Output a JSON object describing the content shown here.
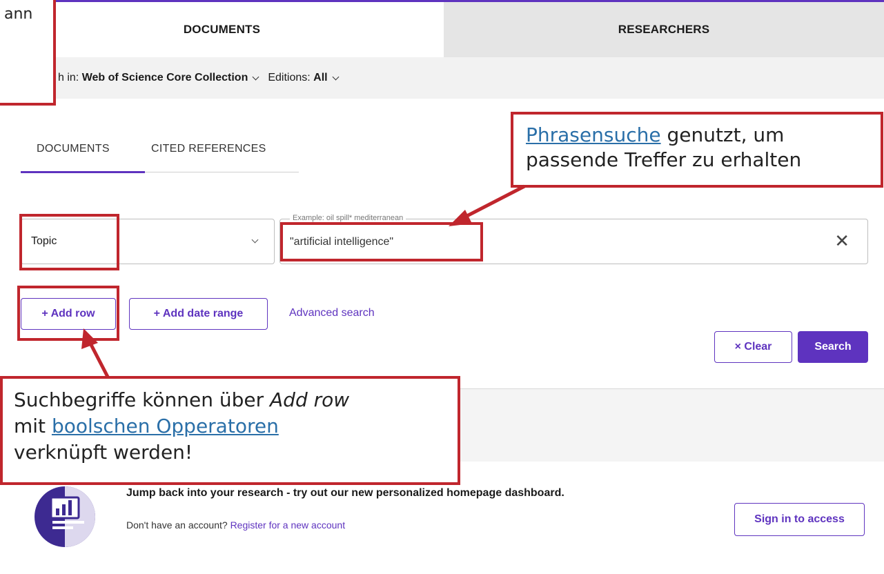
{
  "top_tabs": {
    "documents": "DOCUMENTS",
    "researchers": "RESEARCHERS"
  },
  "search_in": {
    "label": "h in:",
    "collection": "Web of Science Core Collection",
    "editions_label": "Editions:",
    "editions_value": "All"
  },
  "inner_tabs": {
    "documents": "DOCUMENTS",
    "cited": "CITED REFERENCES"
  },
  "search_row": {
    "field": "Topic",
    "placeholder": "Example: oil spill* mediterranean",
    "query": "\"artificial intelligence\"",
    "clear_icon": "close-icon"
  },
  "buttons": {
    "add_row": "+ Add row",
    "add_date": "+ Add date range",
    "advanced": "Advanced search",
    "clear": "× Clear",
    "search": "Search"
  },
  "promo": {
    "title": "Jump back into your research - try out our new personalized homepage dashboard.",
    "sub_text": "Don't have an account?",
    "sub_link": "Register for a new account",
    "sign_in": "Sign in to access"
  },
  "annotations": {
    "top_left": "ann",
    "phrase_link": "Phrasensuche",
    "phrase_rest_1": " genutzt, um",
    "phrase_rest_2": "passende Treffer zu erhalten",
    "bool_1": "Suchbegriffe können über ",
    "bool_1_italic": "Add row",
    "bool_2_prefix": "mit ",
    "bool_2_link": "boolschen Opperatoren",
    "bool_3": "verknüpft werden!"
  },
  "colors": {
    "brand_purple": "#5e33bf",
    "annotation_red": "#c0262d",
    "link_blue": "#2a6fa8"
  }
}
